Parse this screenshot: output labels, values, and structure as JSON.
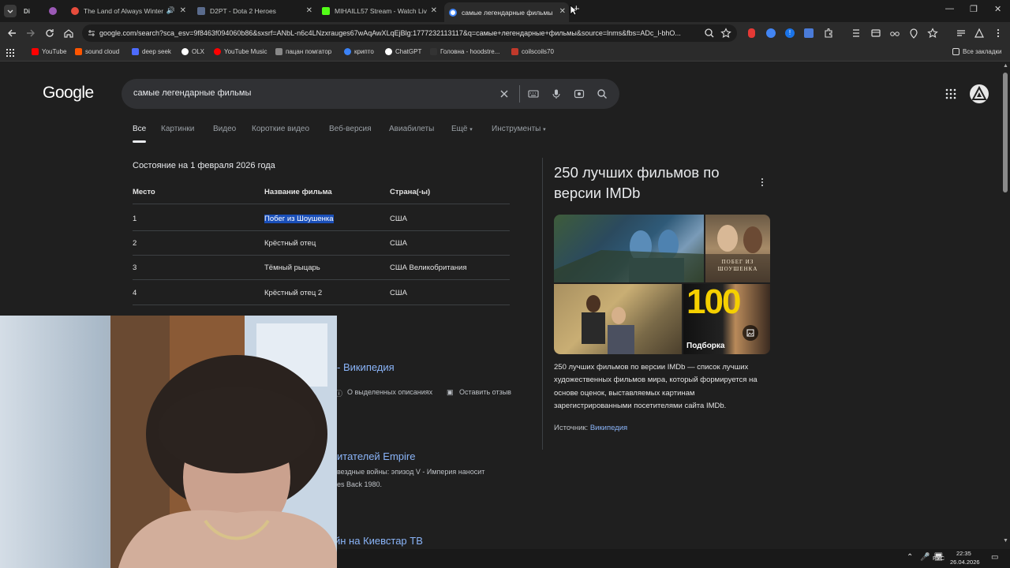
{
  "browser": {
    "tabs": [
      {
        "title": "",
        "fav": "#9b59b6"
      },
      {
        "title": "",
        "fav": "#c4302b"
      },
      {
        "title": "The Land of Always Winter",
        "fav": "#e74c3c"
      },
      {
        "title": "D2PT - Dota 2 Heroes",
        "fav": "#5a6b8c"
      },
      {
        "title": "MIHAILL57 Stream - Watch Liv",
        "fav": "#53fc18"
      },
      {
        "title": "самые легендарные фильмы",
        "fav": "#4285f4"
      }
    ],
    "tab_prefix": "Di",
    "new_tab": "+",
    "window_controls": [
      "—",
      "❐",
      "✕"
    ],
    "url": "google.com/search?sca_esv=9f8463f094060b86&sxsrf=ANbL-n6c4LNzxrauges67wAqAwXLqEjBlg:1777232113117&q=самые+легендарные+фильмы&source=lnms&fbs=ADc_l-bhO..."
  },
  "bookmarks": [
    {
      "label": "YouTube",
      "color": "#ff0000"
    },
    {
      "label": "sound cloud",
      "color": "#ff5500"
    },
    {
      "label": "deep seek",
      "color": "#4d6bfe"
    },
    {
      "label": "OLX",
      "color": "#ffffff"
    },
    {
      "label": "YouTube Music",
      "color": "#ff0000"
    },
    {
      "label": "пацан помгатор",
      "color": "#888888"
    },
    {
      "label": "крипто",
      "color": "#3b82f6"
    },
    {
      "label": "ChatGPT",
      "color": "#ffffff"
    },
    {
      "label": "Головна - hoodstre...",
      "color": "#222222"
    },
    {
      "label": "coilscoils70",
      "color": "#c0392b"
    }
  ],
  "bookmarks_all": "Все закладки",
  "google": {
    "logo": "Google",
    "query": "самые легендарные фильмы",
    "tabs": [
      "Все",
      "Картинки",
      "Видео",
      "Короткие видео",
      "Веб-версия",
      "Авиабилеты",
      "Ещё",
      "Инструменты"
    ]
  },
  "table": {
    "caption": "Состояние на 1 февраля 2026 года",
    "headers": [
      "Место",
      "Название фильма",
      "Страна(-ы)"
    ],
    "rows": [
      [
        "1",
        "Побег из Шоушенка",
        "США"
      ],
      [
        "2",
        "Крёстный отец",
        "США"
      ],
      [
        "3",
        "Тёмный рыцарь",
        "США Великобритания"
      ],
      [
        "4",
        "Крёстный отец 2",
        "США"
      ]
    ]
  },
  "results": {
    "wiki_link": "- Википедия",
    "wiki_meta1": "О выделенных описаниях",
    "wiki_meta2": "Оставить отзыв",
    "empire_link": "итателей Empire",
    "empire_line1": "вездные войны: эпизод V - Империя наносит",
    "empire_line2": "es Back 1980.",
    "kyiv_link": "йн на Киевстар ТВ"
  },
  "knowledge_panel": {
    "title": "250 лучших фильмов по версии IMDb",
    "poster_title": "ПОБЕГ ИЗ ШОУШЕНКА",
    "image_badge": "100",
    "image_caption": "Подборка",
    "description": "250 лучших фильмов по версии IMDb — список лучших художественных фильмов мира, который формируется на основе оценок, выставляемых картинам зарегистрированными посетителями сайта IMDb.",
    "source_label": "Источник:",
    "source_link": "Википедия"
  },
  "taskbar": {
    "lang": "РУС",
    "time": "22:35",
    "date": "26.04.2026"
  }
}
